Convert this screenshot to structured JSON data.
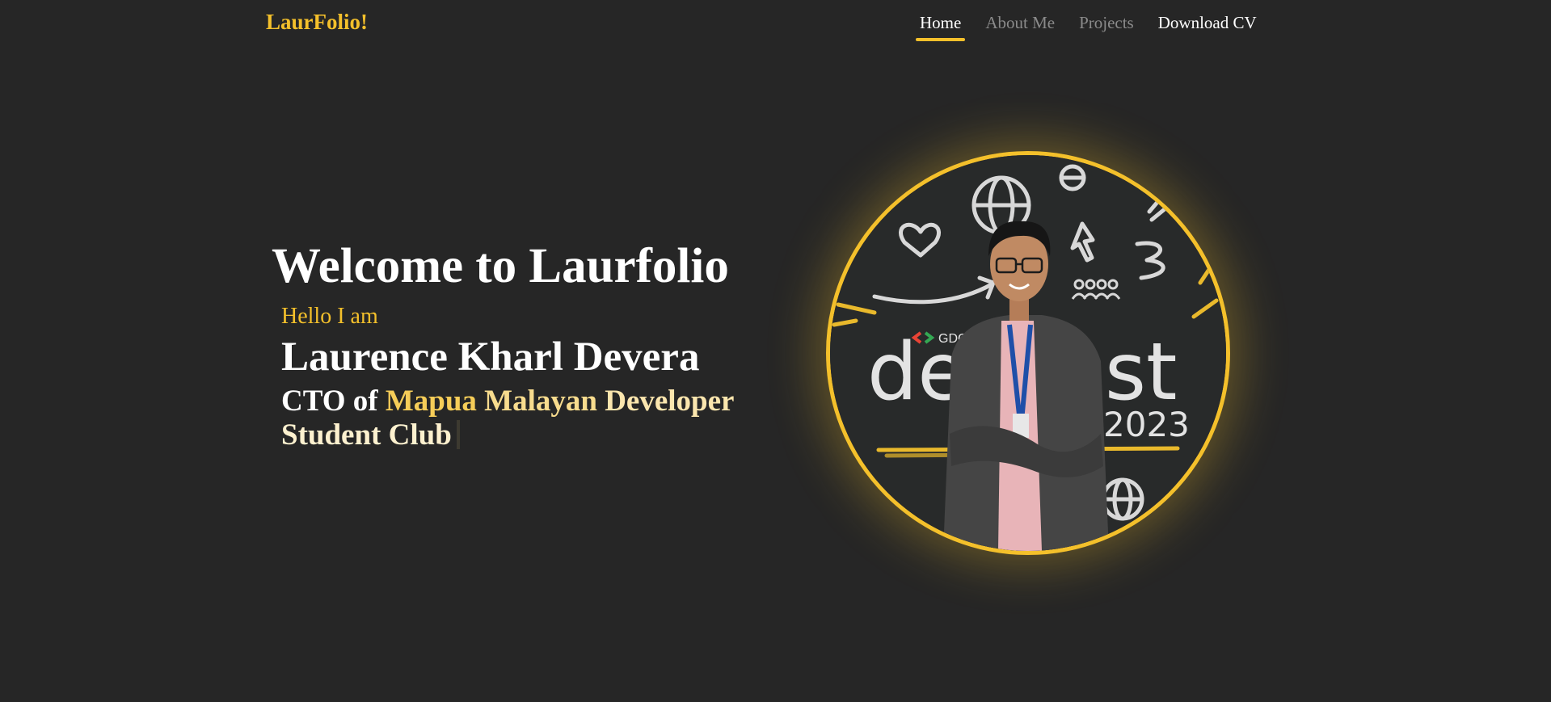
{
  "nav": {
    "brand": "LaurFolio!",
    "links": [
      {
        "label": "Home",
        "active": true
      },
      {
        "label": "About Me"
      },
      {
        "label": "Projects"
      },
      {
        "label": "Download CV"
      }
    ]
  },
  "hero": {
    "welcome": "Welcome to Laurfolio",
    "greeting": "Hello I am",
    "name": "Laurence Kharl Devera",
    "role_words": [
      "CTO of",
      "Mapua",
      "Malayan",
      "Developer",
      "Student Club"
    ]
  },
  "photo": {
    "badge_text": "GDG Davao",
    "banner_left": "dev",
    "banner_right": "st",
    "banner_year": "2023"
  },
  "colors": {
    "background": "#262626",
    "accent": "#f4c02b",
    "text": "#ffffff",
    "muted_nav": "#8a8a8a"
  }
}
